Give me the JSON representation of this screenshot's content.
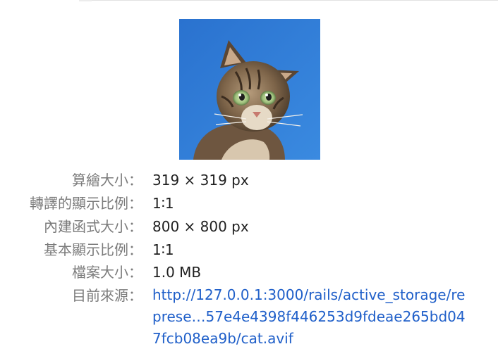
{
  "image": {
    "alt": "cat",
    "icon": "image-preview",
    "colors": {
      "sky": "#2f7fd6",
      "fur": "#8a6f55",
      "eye": "#a8c98a"
    }
  },
  "details": {
    "rendered_size": {
      "label": "算繪大小：",
      "value": "319 × 319 px"
    },
    "rendered_ratio": {
      "label": "轉譯的顯示比例：",
      "value": "1∶1"
    },
    "intrinsic_size": {
      "label": "內建函式大小：",
      "value": "800 × 800 px"
    },
    "intrinsic_ratio": {
      "label": "基本顯示比例：",
      "value": "1∶1"
    },
    "file_size": {
      "label": "檔案大小：",
      "value": "1.0 MB"
    },
    "source": {
      "label": "目前來源：",
      "lines": [
        "http://127.0.0.1:3000/rails/active_storage/re",
        "prese…57e4e4398f446253d9fdeae265bd04",
        "7fcb08ea9b/cat.avif"
      ]
    }
  },
  "colors": {
    "label": "#7b7b7b",
    "value": "#1f1f1f",
    "link": "#1f5fc9"
  }
}
